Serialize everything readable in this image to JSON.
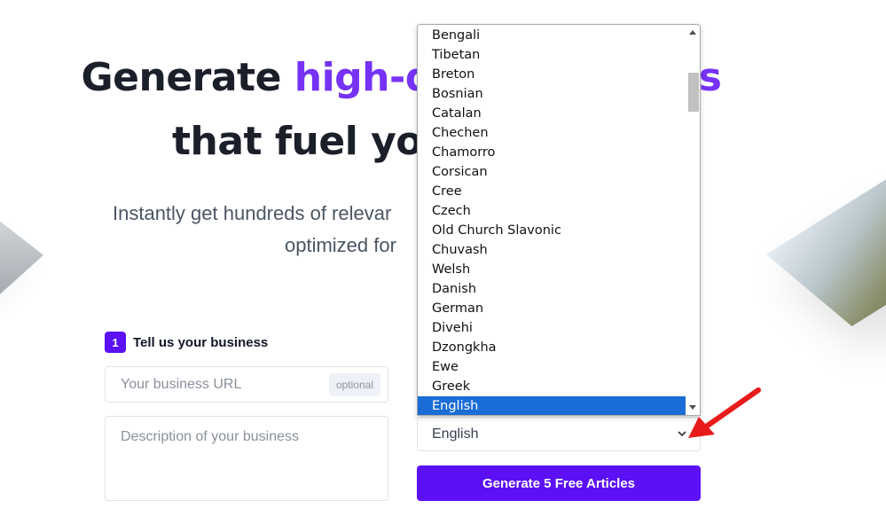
{
  "hero": {
    "line1_prefix": "Generate ",
    "line1_accent": "high-q",
    "line1_suffix": "s",
    "line2": "that fuel you",
    "sub1": "Instantly get hundreds of relevar",
    "sub2": "optimized for"
  },
  "step1": {
    "number": "1",
    "title": "Tell us your business"
  },
  "form": {
    "url_placeholder": "Your business URL",
    "url_badge": "optional",
    "description_placeholder": "Description of your business",
    "language_selected": "English",
    "generate_label": "Generate 5 Free Articles"
  },
  "language_dropdown": {
    "options": [
      "Bengali",
      "Tibetan",
      "Breton",
      "Bosnian",
      "Catalan",
      "Chechen",
      "Chamorro",
      "Corsican",
      "Cree",
      "Czech",
      "Old Church Slavonic",
      "Chuvash",
      "Welsh",
      "Danish",
      "German",
      "Divehi",
      "Dzongkha",
      "Ewe",
      "Greek",
      "English"
    ],
    "highlighted": "English"
  },
  "colors": {
    "accent": "#7733f5",
    "brand_button": "#5b10f5",
    "selection": "#1a6cd6",
    "annotation_arrow": "#e81b1b"
  },
  "icons": {
    "select_chevron": "chevron-down-icon",
    "annotation": "red-arrow-icon"
  }
}
